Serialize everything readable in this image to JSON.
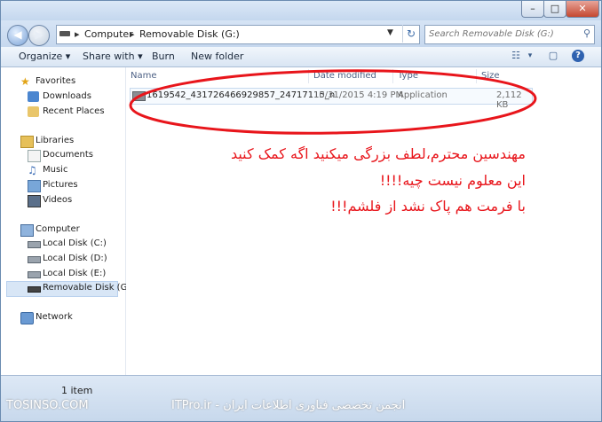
{
  "window": {
    "minimize": "–",
    "maximize": "□",
    "close": "✕"
  },
  "address": {
    "path": [
      "Computer",
      "Removable Disk (G:)"
    ],
    "separator": "▸",
    "refresh_icon": "refresh-icon"
  },
  "search": {
    "placeholder": "Search Removable Disk (G:)"
  },
  "toolbar": {
    "organize": "Organize ▾",
    "share_with": "Share with ▾",
    "burn": "Burn",
    "new_folder": "New folder",
    "view_caret": "▾"
  },
  "sidebar": {
    "favorites": {
      "label": "Favorites",
      "items": [
        "Downloads",
        "Recent Places"
      ]
    },
    "libraries": {
      "label": "Libraries",
      "items": [
        "Documents",
        "Music",
        "Pictures",
        "Videos"
      ]
    },
    "computer": {
      "label": "Computer",
      "items": [
        "Local Disk (C:)",
        "Local Disk (D:)",
        "Local Disk (E:)",
        "Removable Disk (G:)"
      ],
      "selected": "Removable Disk (G:)"
    },
    "network": {
      "label": "Network"
    }
  },
  "columns": {
    "name": "Name",
    "date": "Date modified",
    "type": "Type",
    "size": "Size"
  },
  "files": [
    {
      "name": "1619542_431726466929857_24717115_n",
      "date": "10/31/2015 4:19 PM",
      "type": "Application",
      "size": "2,112 KB"
    }
  ],
  "annotation": {
    "lines": [
      "مهندسین محترم،لطف بزرگی میکنید اگه کمک کنید",
      "این معلوم نیست چیه!!!!",
      "با فرمت هم پاک نشد از فلشم!!!"
    ],
    "color": "#e8151b"
  },
  "status": {
    "count": "1 item"
  },
  "watermark": {
    "left": "TOSINSO.COM",
    "right": "ITPro.ir - انجمن تخصصی فناوری اطلاعات ایران"
  }
}
